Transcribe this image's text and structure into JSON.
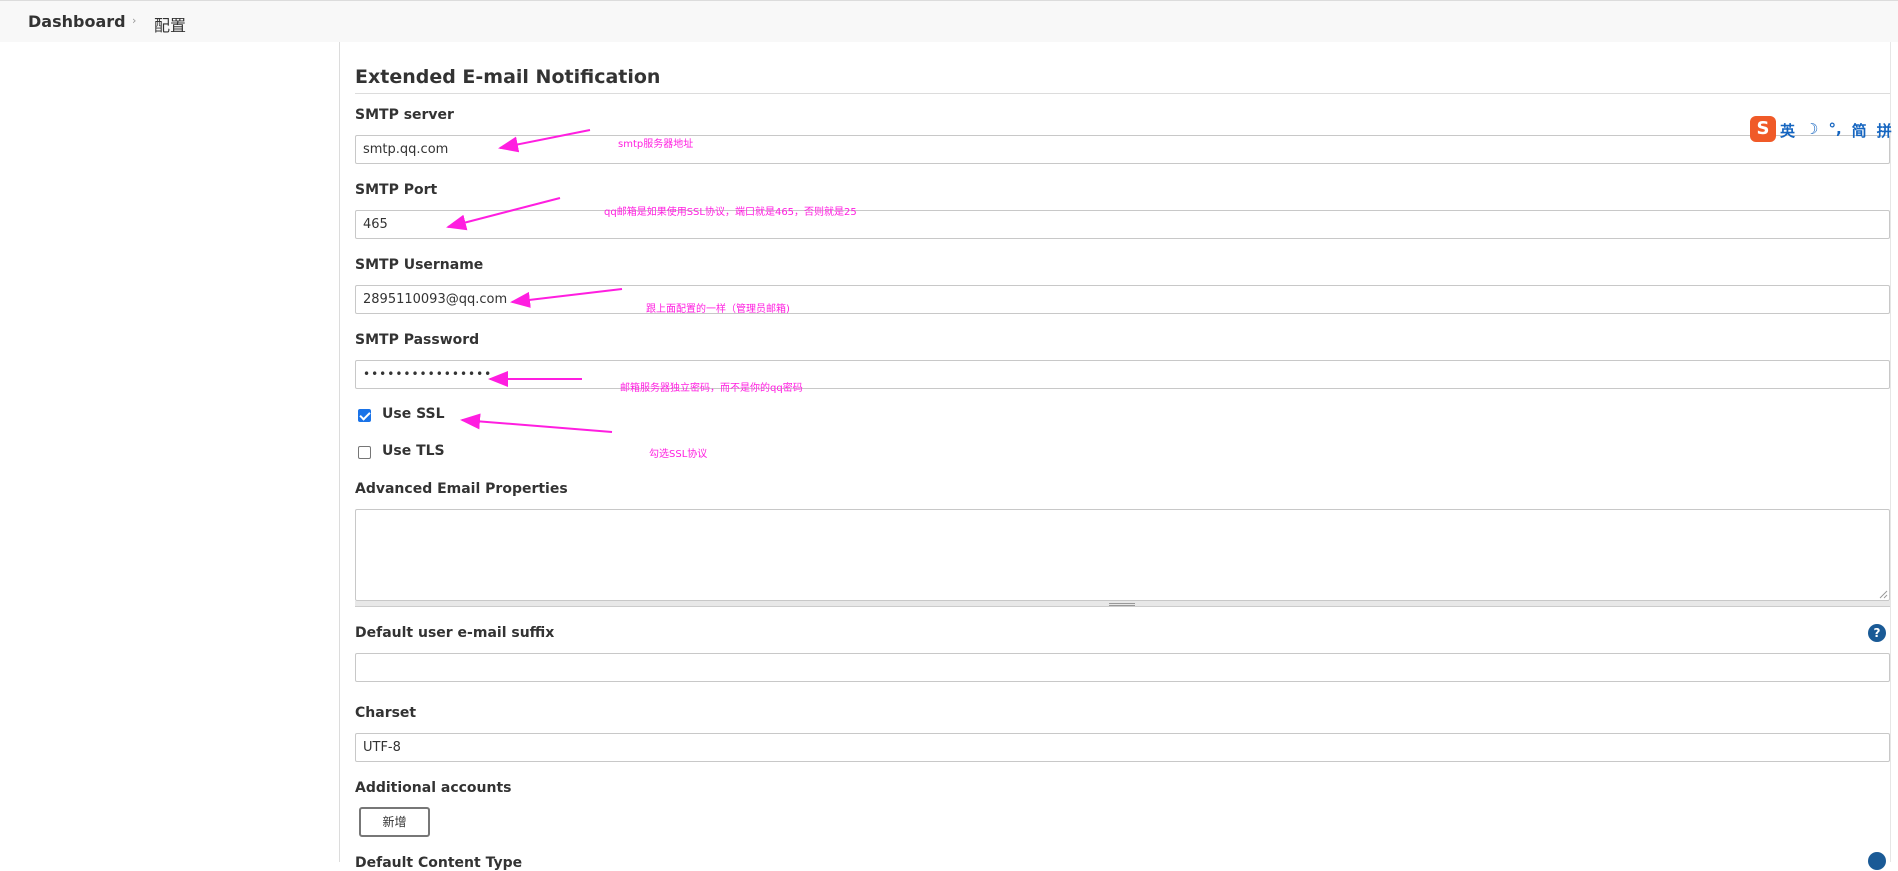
{
  "breadcrumb": {
    "dashboard": "Dashboard",
    "current": "配置"
  },
  "section": {
    "title": "Extended E-mail Notification"
  },
  "fields": {
    "smtp_server": {
      "label": "SMTP server",
      "value": "smtp.qq.com"
    },
    "smtp_port": {
      "label": "SMTP Port",
      "value": "465"
    },
    "smtp_username": {
      "label": "SMTP Username",
      "value": "2895110093@qq.com"
    },
    "smtp_password": {
      "label": "SMTP Password",
      "value": "••••••••••••••••"
    },
    "use_ssl": {
      "label": "Use SSL",
      "checked": true
    },
    "use_tls": {
      "label": "Use TLS",
      "checked": false
    },
    "advanced_props": {
      "label": "Advanced Email Properties",
      "value": ""
    },
    "default_suffix": {
      "label": "Default user e-mail suffix",
      "value": ""
    },
    "charset": {
      "label": "Charset",
      "value": "UTF-8"
    },
    "additional_accounts": {
      "label": "Additional accounts",
      "button": "新增"
    },
    "next_label_cut": "Default Content Type"
  },
  "annotations": {
    "smtp_server": "smtp服务器地址",
    "smtp_port": "qq邮箱是如果使用SSL协议，端口就是465，否则就是25",
    "smtp_username": "跟上面配置的一样（管理员邮箱)",
    "smtp_password": "邮箱服务器独立密码，而不是你的qq密码",
    "use_ssl": "勾选SSL协议"
  },
  "annotation_color": "#ff1ee0",
  "ime_toolbar": {
    "logo": "S",
    "items": [
      "英",
      "☽",
      "°,",
      "简",
      "拼"
    ]
  },
  "help_icon": "?"
}
